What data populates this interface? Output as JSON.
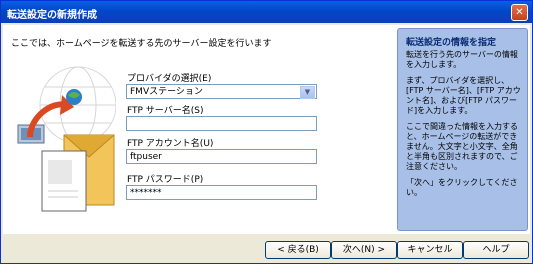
{
  "window": {
    "title": "転送設定の新規作成",
    "close": "✕"
  },
  "intro": "ここでは、ホームページを転送する先のサーバー設定を行います",
  "fields": {
    "provider": {
      "label": "プロバイダの選択(E)",
      "value": "FMVステーション"
    },
    "ftp_server": {
      "label": "FTP サーバー名(S)",
      "value": ""
    },
    "ftp_account": {
      "label": "FTP アカウント名(U)",
      "value": "ftpuser"
    },
    "ftp_password": {
      "label": "FTP パスワード(P)",
      "value": "*******"
    }
  },
  "help": {
    "title": "転送設定の情報を指定",
    "p1": "転送を行う先のサーバーの情報を入力します。",
    "p2": "まず、プロバイダを選択し、[FTP サーバー名]、[FTP アカウント名]、および[FTP パスワード]を入力します。",
    "p3": "ここで間違った情報を入力すると、ホームページの転送ができません。大文字と小文字、全角と半角も区別されますので、ご注意ください。",
    "p4": "「次へ」をクリックしてください。"
  },
  "buttons": {
    "back": "< 戻る(B)",
    "next": "次へ(N) >",
    "cancel": "キャンセル",
    "help": "ヘルプ"
  }
}
